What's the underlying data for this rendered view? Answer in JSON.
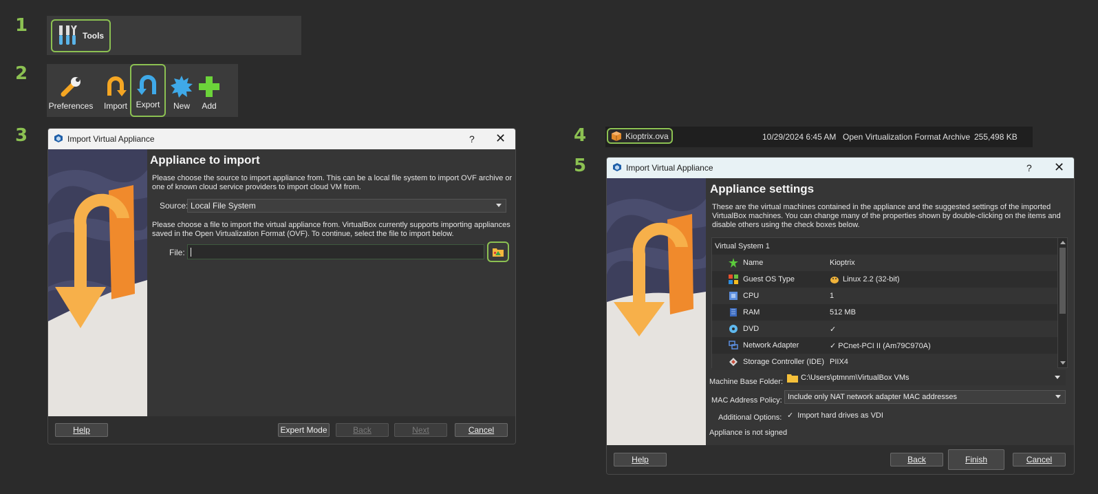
{
  "steps": [
    "1",
    "2",
    "3",
    "4",
    "5"
  ],
  "step1": {
    "tools_label": "Tools"
  },
  "step2": {
    "items": [
      {
        "label": "Preferences"
      },
      {
        "label": "Import"
      },
      {
        "label": "Export"
      },
      {
        "label": "New"
      },
      {
        "label": "Add"
      }
    ]
  },
  "step3": {
    "title": "Import Virtual Appliance",
    "help_glyph": "?",
    "close_glyph": "✕",
    "heading": "Appliance to import",
    "intro_line1": "Please choose the source to import appliance from. This can be a local file system to import OVF archive or",
    "intro_line2": "one of known cloud service providers to import cloud VM from.",
    "source_label": "Source:",
    "source_value": "Local File System",
    "file_text_line1": "Please choose a file to import the virtual appliance from. VirtualBox currently supports importing appliances",
    "file_text_line2": "saved in the Open Virtualization Format (OVF). To continue, select the file to import below.",
    "file_label": "File:",
    "file_value": "",
    "buttons": {
      "help": "Help",
      "expert": "Expert Mode",
      "back": "Back",
      "next": "Next",
      "cancel": "Cancel"
    }
  },
  "step4": {
    "filename": "Kioptrix.ova",
    "date": "10/29/2024 6:45 AM",
    "type": "Open Virtualization Format Archive",
    "size": "255,498 KB"
  },
  "step5": {
    "title": "Import Virtual Appliance",
    "help_glyph": "?",
    "close_glyph": "✕",
    "heading": "Appliance settings",
    "intro_line1": "These are the virtual machines contained in the appliance and the suggested settings of the imported",
    "intro_line2": "VirtualBox machines. You can change many of the properties shown by double-clicking on the items and",
    "intro_line3": "disable others using the check boxes below.",
    "system_label": "Virtual System 1",
    "rows": [
      {
        "key": "Name",
        "value": "Kioptrix"
      },
      {
        "key": "Guest OS Type",
        "value": "Linux 2.2 (32-bit)"
      },
      {
        "key": "CPU",
        "value": "1"
      },
      {
        "key": "RAM",
        "value": "512 MB"
      },
      {
        "key": "DVD",
        "value": "✓"
      },
      {
        "key": "Network Adapter",
        "value": "✓  PCnet-PCI II (Am79C970A)"
      },
      {
        "key": "Storage Controller (IDE)",
        "value": "PIIX4"
      }
    ],
    "base_folder_label": "Machine Base Folder:",
    "base_folder_value": "C:\\Users\\ptmnm\\VirtualBox VMs",
    "mac_label": "MAC Address Policy:",
    "mac_value": "Include only NAT network adapter MAC addresses",
    "options_label": "Additional Options:",
    "options_value": "Import hard drives as VDI",
    "options_check": "✓",
    "signed_text": "Appliance is not signed",
    "buttons": {
      "help": "Help",
      "back": "Back",
      "finish": "Finish",
      "cancel": "Cancel"
    }
  }
}
